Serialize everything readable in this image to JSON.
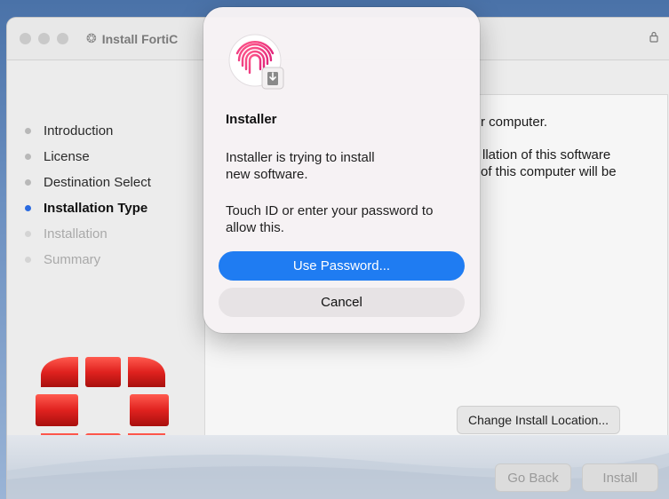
{
  "window": {
    "title": "Install FortiC",
    "lock_icon": "lock-icon",
    "app_icon": "package-icon"
  },
  "sidebar": {
    "steps": [
      {
        "label": "Introduction",
        "state": "done"
      },
      {
        "label": "License",
        "state": "done"
      },
      {
        "label": "Destination Select",
        "state": "done"
      },
      {
        "label": "Installation Type",
        "state": "active"
      },
      {
        "label": "Installation",
        "state": "pending"
      },
      {
        "label": "Summary",
        "state": "pending"
      }
    ]
  },
  "content": {
    "line1": "r computer.",
    "line2a": "llation of this software",
    "line2b": "of this computer will be",
    "change_location_label": "Change Install Location..."
  },
  "footer": {
    "go_back_label": "Go Back",
    "install_label": "Install"
  },
  "dialog": {
    "icon": "touch-id-fingerprint-icon",
    "title": "Installer",
    "message_line1": "Installer is trying to install",
    "message_line2": "new software.",
    "prompt_line1": "Touch ID or enter your password to",
    "prompt_line2": "allow this.",
    "use_password_label": "Use Password...",
    "cancel_label": "Cancel"
  },
  "colors": {
    "accent": "#1f7cf2",
    "active_step_dot": "#2a6ae0",
    "logo_red": "#e0221f"
  }
}
